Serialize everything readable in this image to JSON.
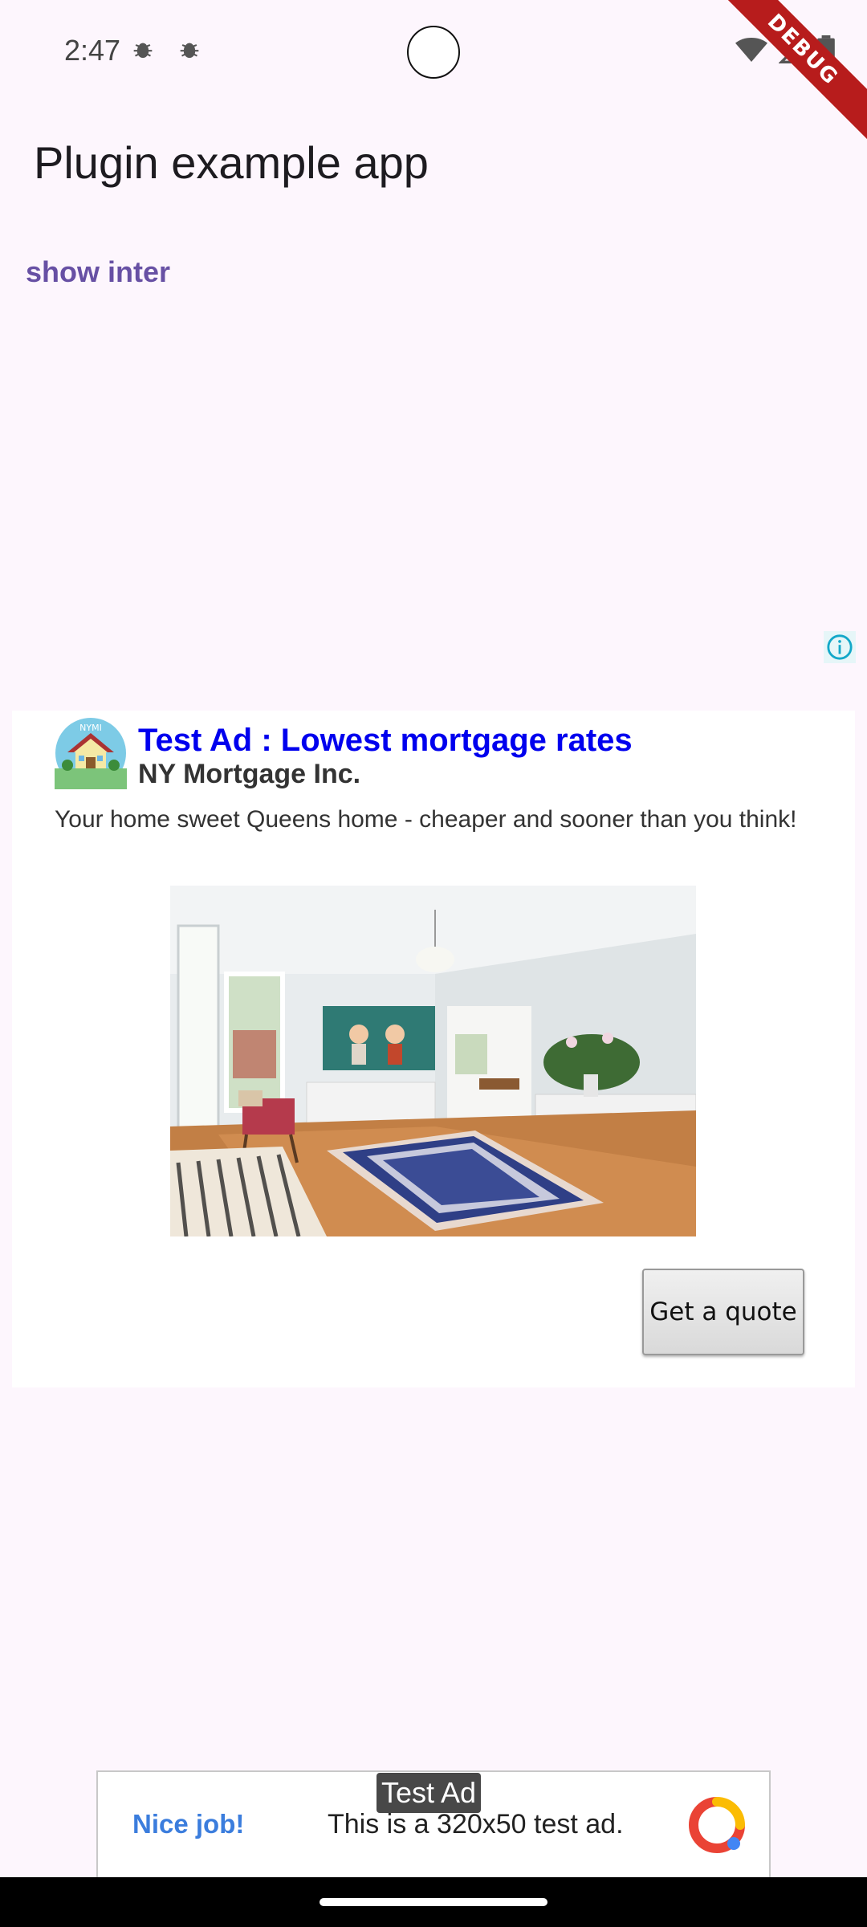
{
  "status_bar": {
    "time": "2:47",
    "notification_icons": [
      "bug-icon",
      "bug-icon"
    ],
    "right_icons": [
      "wifi-icon",
      "signal-icon",
      "battery-icon"
    ],
    "debug_label": "DEBUG"
  },
  "app_bar": {
    "title": "Plugin example app"
  },
  "actions": {
    "show_inter_label": "show inter"
  },
  "native_ad": {
    "headline": "Test Ad : Lowest mortgage rates",
    "advertiser": "NY Mortgage Inc.",
    "logo_text": "NYMI",
    "body": "Your home sweet Queens home - cheaper and sooner than you think!",
    "cta_label": "Get a quote",
    "image_icon": "living-room-photo",
    "adchoices_icon": "info-icon",
    "headline_color": "#0000ee"
  },
  "banner_ad": {
    "tag": "Test Ad",
    "left_text": "Nice job!",
    "text": "This is a 320x50 test ad.",
    "logo_icon": "admob-logo-icon"
  },
  "colors": {
    "background": "#fdf6fd",
    "accent": "#6750a4",
    "debug": "#b71c1c"
  }
}
